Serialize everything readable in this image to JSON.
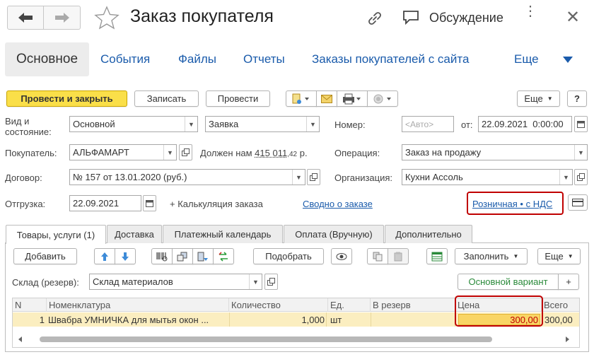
{
  "window": {
    "title": "Заказ покупателя",
    "discussion_label": "Обсуждение"
  },
  "nav_tabs": [
    {
      "label": "Основное"
    },
    {
      "label": "События"
    },
    {
      "label": "Файлы"
    },
    {
      "label": "Отчеты"
    },
    {
      "label": "Заказы покупателей с сайта"
    },
    {
      "label": "Еще"
    }
  ],
  "toolbar": {
    "post_close": "Провести и закрыть",
    "save": "Записать",
    "post": "Провести",
    "more": "Еще",
    "help": "?"
  },
  "form": {
    "kind_label": "Вид и состояние:",
    "kind_value": "Основной",
    "state_value": "Заявка",
    "number_label": "Номер:",
    "number_placeholder": "<Авто>",
    "date_label": "от:",
    "date_value": "22.09.2021  0:00:00",
    "buyer_label": "Покупатель:",
    "buyer_value": "АЛЬФАМАРТ",
    "debt_label": "Должен нам",
    "debt_amount": "415 011",
    "debt_cents": ",42",
    "debt_currency": "р.",
    "operation_label": "Операция:",
    "operation_value": "Заказ на продажу",
    "contract_label": "Договор:",
    "contract_value": "№ 157 от 13.01.2020 (руб.)",
    "org_label": "Организация:",
    "org_value": "Кухни Ассоль",
    "shipment_label": "Отгрузка:",
    "shipment_value": "22.09.2021",
    "calc_label": "+ Калькуляция заказа",
    "summary_link": "Сводно о заказе",
    "price_type_link": "Розничная • с НДС"
  },
  "doc_tabs": [
    {
      "label": "Товары, услуги (1)"
    },
    {
      "label": "Доставка"
    },
    {
      "label": "Платежный календарь"
    },
    {
      "label": "Оплата (Вручную)"
    },
    {
      "label": "Дополнительно"
    }
  ],
  "items_toolbar": {
    "add": "Добавить",
    "pick": "Подобрать",
    "fill": "Заполнить",
    "more": "Еще"
  },
  "warehouse": {
    "label": "Склад (резерв):",
    "value": "Склад материалов",
    "variant_button": "Основной вариант",
    "plus": "+"
  },
  "table": {
    "columns": [
      "N",
      "Номенклатура",
      "Количество",
      "Ед.",
      "В резерв",
      "Цена",
      "Всего"
    ],
    "rows": [
      {
        "n": "1",
        "item": "Швабра УМНИЧКА для мытья окон ...",
        "qty": "1,000",
        "unit": "шт",
        "reserve": "",
        "price": "300,00",
        "total": "300,00"
      }
    ]
  },
  "colors": {
    "accent_yellow": "#fadf49",
    "link_blue": "#1a5bab",
    "highlight_red": "#c00000",
    "row_selected": "#fbeec0"
  }
}
